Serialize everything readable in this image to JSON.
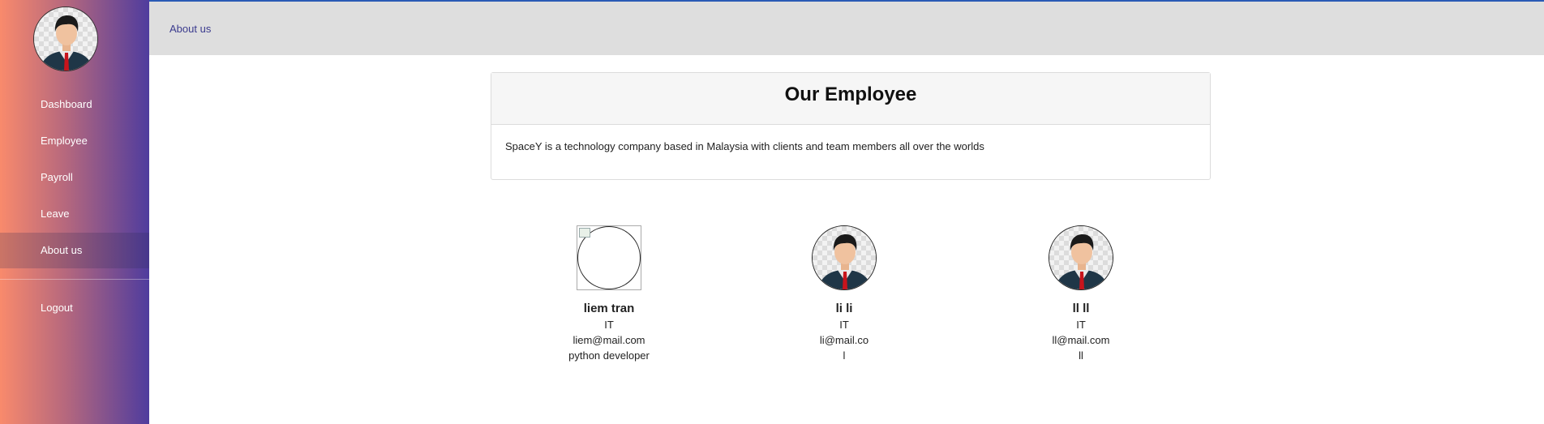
{
  "sidebar": {
    "items": [
      {
        "label": "Dashboard"
      },
      {
        "label": "Employee"
      },
      {
        "label": "Payroll"
      },
      {
        "label": "Leave"
      },
      {
        "label": "About us"
      },
      {
        "label": "Logout"
      }
    ],
    "active": "About us"
  },
  "header": {
    "breadcrumb": "About us"
  },
  "card": {
    "title": "Our Employee",
    "description": "SpaceY is a technology company based in Malaysia with clients and team members all over the worlds"
  },
  "employees": [
    {
      "name": "liem tran",
      "department": "IT",
      "email": "liem@mail.com",
      "role": "python developer",
      "avatar": "broken-image-icon"
    },
    {
      "name": "li li",
      "department": "IT",
      "email": "li@mail.co",
      "role": "l",
      "avatar": "person-avatar-icon"
    },
    {
      "name": "ll ll",
      "department": "IT",
      "email": "ll@mail.com",
      "role": "ll",
      "avatar": "person-avatar-icon"
    }
  ],
  "colors": {
    "sidebar_gradient_start": "#f98a6c",
    "sidebar_gradient_end": "#4f3c9e",
    "topbar_bg": "#dedede",
    "topbar_accent": "#2a5bb5",
    "link": "#3b3b8e"
  }
}
